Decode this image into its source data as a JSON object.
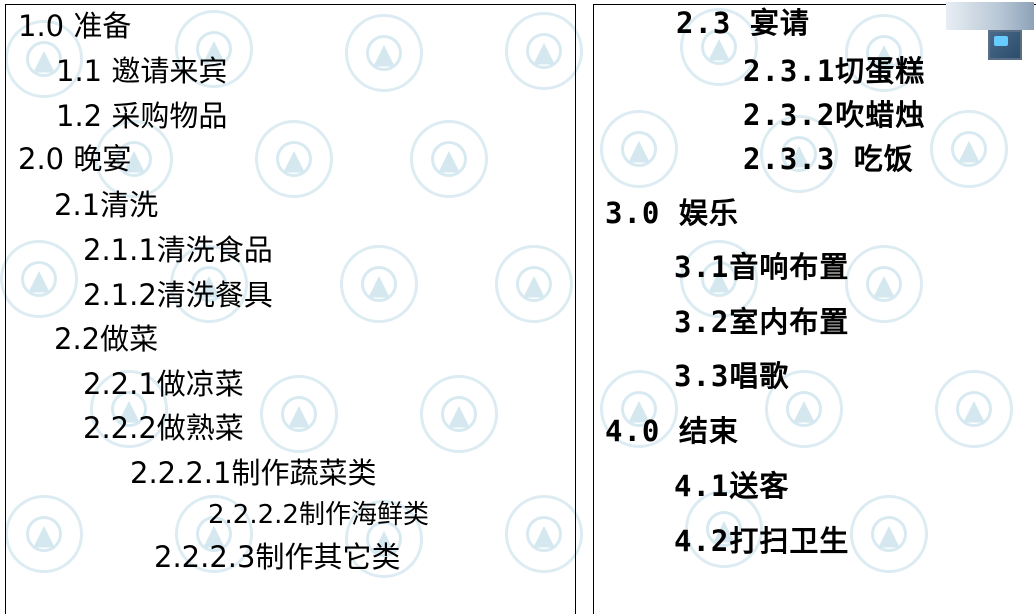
{
  "left_outline": [
    {
      "label": "1.0 准备"
    },
    {
      "label": "1.1 邀请来宾"
    },
    {
      "label": "1.2 采购物品"
    },
    {
      "label": "2.0 晚宴"
    },
    {
      "label": "2.1清洗"
    },
    {
      "label": "2.1.1清洗食品"
    },
    {
      "label": "2.1.2清洗餐具"
    },
    {
      "label": "2.2做菜"
    },
    {
      "label": "2.2.1做凉菜"
    },
    {
      "label": "2.2.2做熟菜"
    },
    {
      "label": "2.2.2.1制作蔬菜类"
    },
    {
      "label": "2.2.2.2制作海鲜类"
    },
    {
      "label": "2.2.2.3制作其它类"
    }
  ],
  "right_outline": [
    {
      "label": "2.3 宴请"
    },
    {
      "label": "2.3.1切蛋糕"
    },
    {
      "label": "2.3.2吹蜡烛"
    },
    {
      "label": "2.3.3 吃饭"
    },
    {
      "label": "3.0 娱乐"
    },
    {
      "label": "3.1音响布置"
    },
    {
      "label": "3.2室内布置"
    },
    {
      "label": "3.3唱歌"
    },
    {
      "label": "4.0 结束"
    },
    {
      "label": "4.1送客"
    },
    {
      "label": "4.2打扫卫生"
    }
  ],
  "colors": {
    "text": "#000000",
    "watermark": "#dcecf2",
    "border": "#000000"
  },
  "icons": {
    "watermark": "university-seal-icon",
    "corner": "computer-screen-icon"
  }
}
